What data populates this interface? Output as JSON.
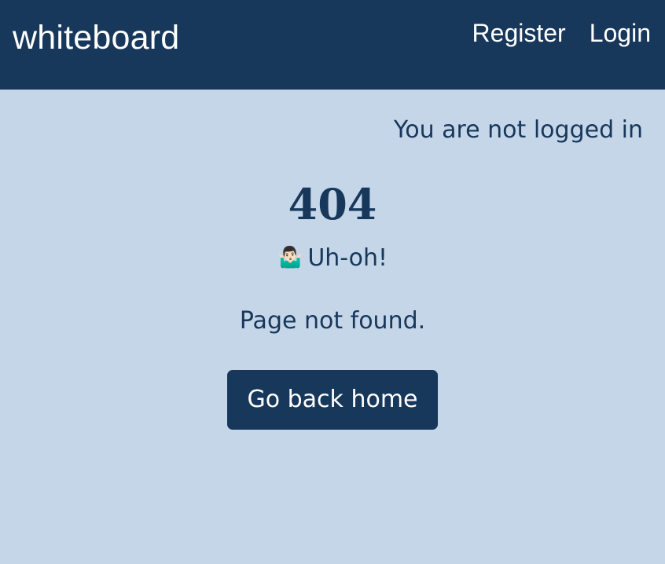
{
  "navbar": {
    "brand": "whiteboard",
    "links": [
      {
        "label": "Register"
      },
      {
        "label": "Login"
      }
    ]
  },
  "auth_status": "You are not logged in",
  "error": {
    "code": "404",
    "emoji": "🤷🏻‍♂️",
    "headline": "Uh-oh!",
    "message": "Page not found.",
    "button_label": "Go back home"
  },
  "colors": {
    "navbar_bg": "#17375b",
    "page_bg": "#c5d6e8",
    "text": "#17375b",
    "button_bg": "#17375b",
    "button_text": "#ffffff"
  }
}
